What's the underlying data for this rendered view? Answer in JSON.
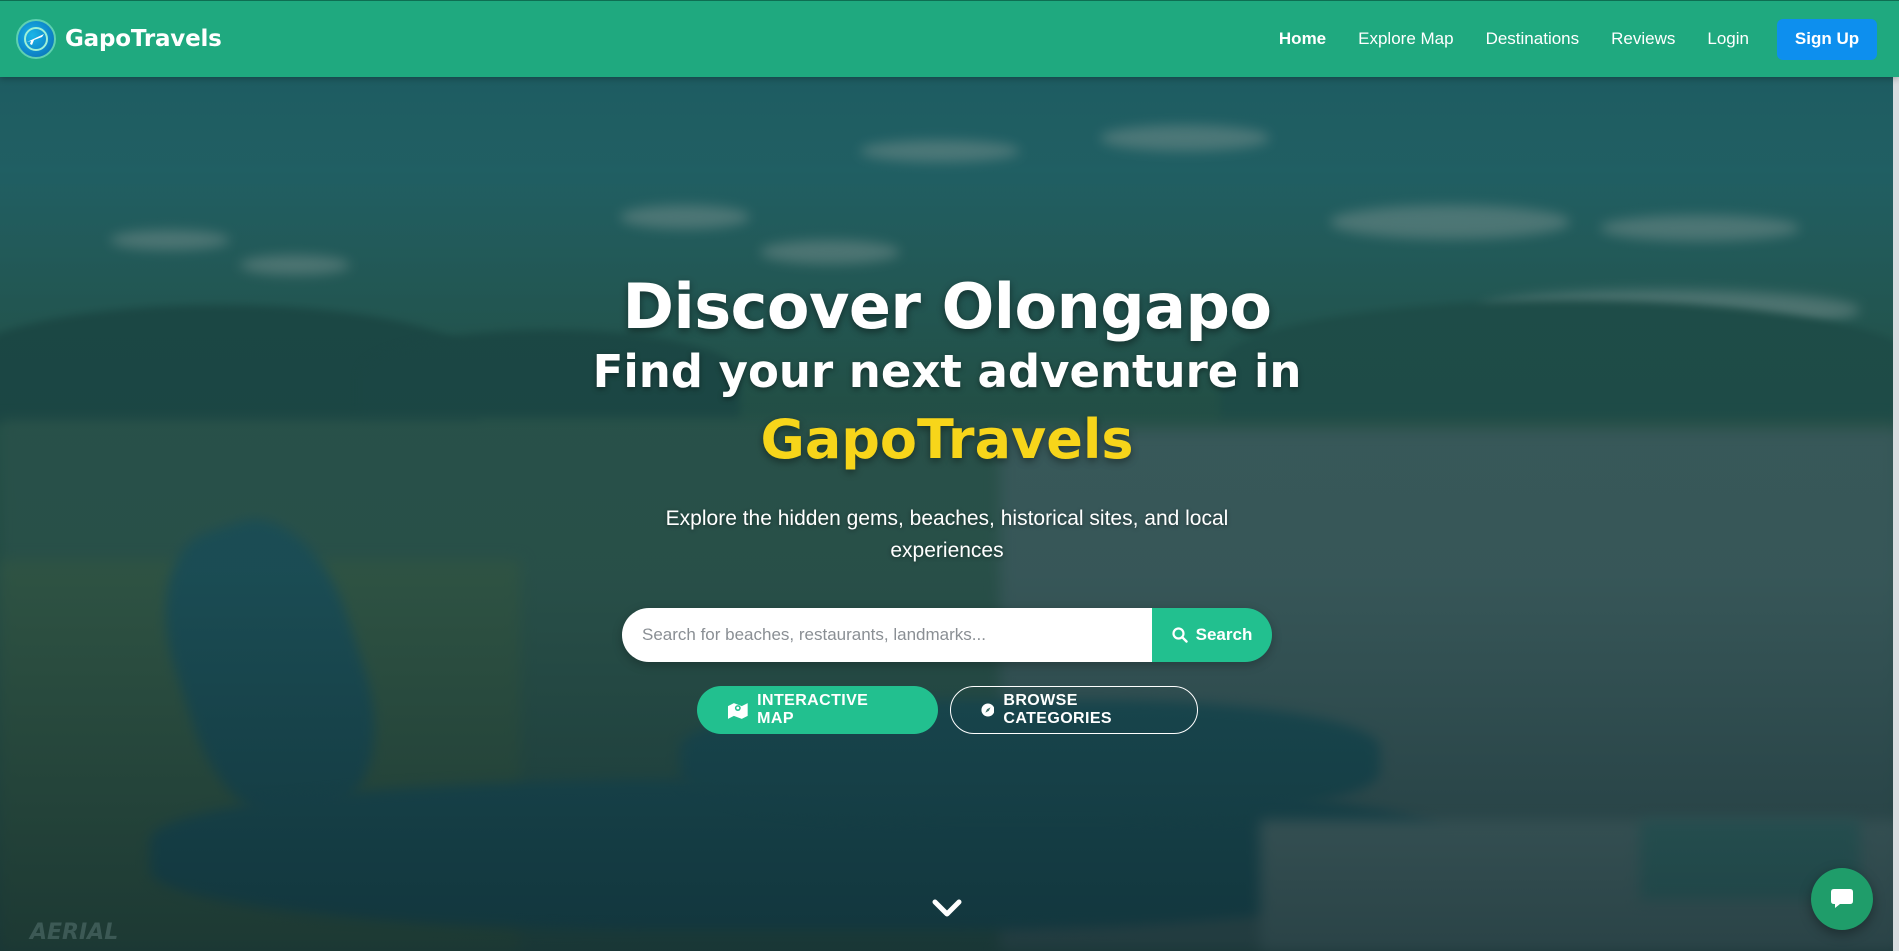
{
  "brand": {
    "name": "GapoTravels",
    "logo_icon": "airplane-globe-icon",
    "primary_color": "#1fa97f",
    "accent_color": "#f7d51a"
  },
  "nav": {
    "links": [
      {
        "label": "Home",
        "active": true
      },
      {
        "label": "Explore Map",
        "active": false
      },
      {
        "label": "Destinations",
        "active": false
      },
      {
        "label": "Reviews",
        "active": false
      },
      {
        "label": "Login",
        "active": false
      }
    ],
    "signup_label": "Sign Up",
    "signup_color": "#0d8fee"
  },
  "hero": {
    "title": "Discover Olongapo",
    "subtitle": "Find your next adventure in",
    "brand_highlight": "GapoTravels",
    "description": "Explore the hidden gems, beaches, historical sites, and local experiences"
  },
  "search": {
    "placeholder": "Search for beaches, restaurants, landmarks...",
    "value": "",
    "button_label": "Search",
    "button_icon": "search-icon"
  },
  "cta": {
    "map_label": "INTERACTIVE MAP",
    "map_icon": "map-icon",
    "browse_label": "BROWSE CATEGORIES",
    "browse_icon": "compass-icon"
  },
  "scroll": {
    "icon": "chevron-down-icon"
  },
  "chat": {
    "icon": "chat-bubble-icon"
  },
  "watermark": "AERIAL"
}
